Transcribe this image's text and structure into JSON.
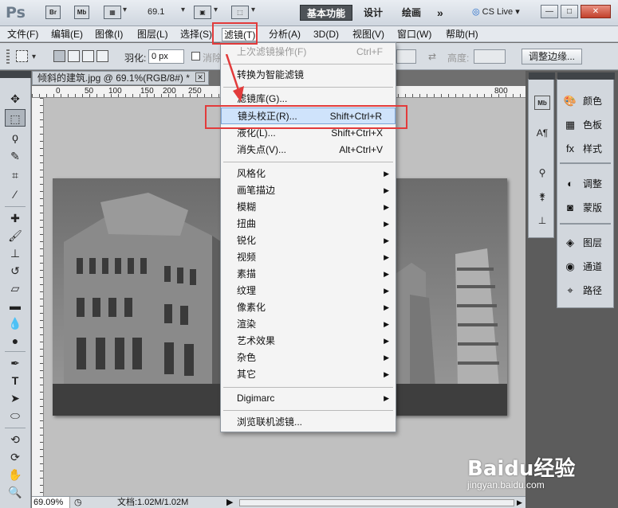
{
  "appbar": {
    "logo": "Ps",
    "icons": [
      "Br",
      "Mb"
    ],
    "zoom": "69.1",
    "workspaces": [
      "基本功能",
      "设计",
      "绘画"
    ],
    "more": "»",
    "cslive": "CS Live",
    "window_controls": [
      "—",
      "□",
      "✕"
    ]
  },
  "menubar": {
    "items": [
      "文件(F)",
      "编辑(E)",
      "图像(I)",
      "图层(L)",
      "选择(S)",
      "滤镜(T)",
      "分析(A)",
      "3D(D)",
      "视图(V)",
      "窗口(W)",
      "帮助(H)"
    ]
  },
  "options": {
    "feather_label": "羽化:",
    "feather_value": "0 px",
    "antialias_label": "消除",
    "height_label": "高度:",
    "refine_edge": "调整边缘..."
  },
  "tools": [
    "move-tool",
    "marquee-tool",
    "lasso-tool",
    "quick-select-tool",
    "crop-tool",
    "eyedropper-tool",
    "spot-heal-tool",
    "brush-tool",
    "clone-stamp-tool",
    "history-brush-tool",
    "eraser-tool",
    "gradient-tool",
    "blur-tool",
    "dodge-tool",
    "pen-tool",
    "type-tool",
    "path-select-tool",
    "shape-tool",
    "rotate-3d-tool",
    "orbit-3d-tool",
    "hand-tool",
    "zoom-tool"
  ],
  "document": {
    "tab_title": "倾斜的建筑.jpg @ 69.1%(RGB/8#) *",
    "ruler_marks": [
      "0",
      "50",
      "100",
      "150",
      "200",
      "250",
      "800"
    ],
    "status_zoom": "69.09%",
    "status_doc": "文档:1.02M/1.02M"
  },
  "filter_menu": {
    "last_filter": {
      "label": "上次滤镜操作(F)",
      "shortcut": "Ctrl+F"
    },
    "smart": "转换为智能滤镜",
    "gallery": "滤镜库(G)...",
    "lens_correction": {
      "label": "镜头校正(R)...",
      "shortcut": "Shift+Ctrl+R"
    },
    "liquify": {
      "label": "液化(L)...",
      "shortcut": "Shift+Ctrl+X"
    },
    "vanishing": {
      "label": "消失点(V)...",
      "shortcut": "Alt+Ctrl+V"
    },
    "submenus": [
      "风格化",
      "画笔描边",
      "模糊",
      "扭曲",
      "锐化",
      "视频",
      "素描",
      "纹理",
      "像素化",
      "渲染",
      "艺术效果",
      "杂色",
      "其它"
    ],
    "digimarc": "Digimarc",
    "browse": "浏览联机滤镜..."
  },
  "right_panels": {
    "col1_icons": [
      "mini-bridge-icon",
      "character-icon",
      "brush-panel-icon",
      "clone-source-icon",
      "tool-presets-icon"
    ],
    "col1_labels": [
      "Mb"
    ],
    "group1": [
      "颜色",
      "色板",
      "样式"
    ],
    "group2": [
      "调整",
      "蒙版"
    ],
    "group3": [
      "图层",
      "通道",
      "路径"
    ]
  },
  "watermark": {
    "brand": "Baidu经验",
    "url": "jingyan.baidu.com"
  },
  "colors": {
    "highlight": "#cfe3fb",
    "annotation": "#e23b3b",
    "active_ws": "#4e5358"
  }
}
